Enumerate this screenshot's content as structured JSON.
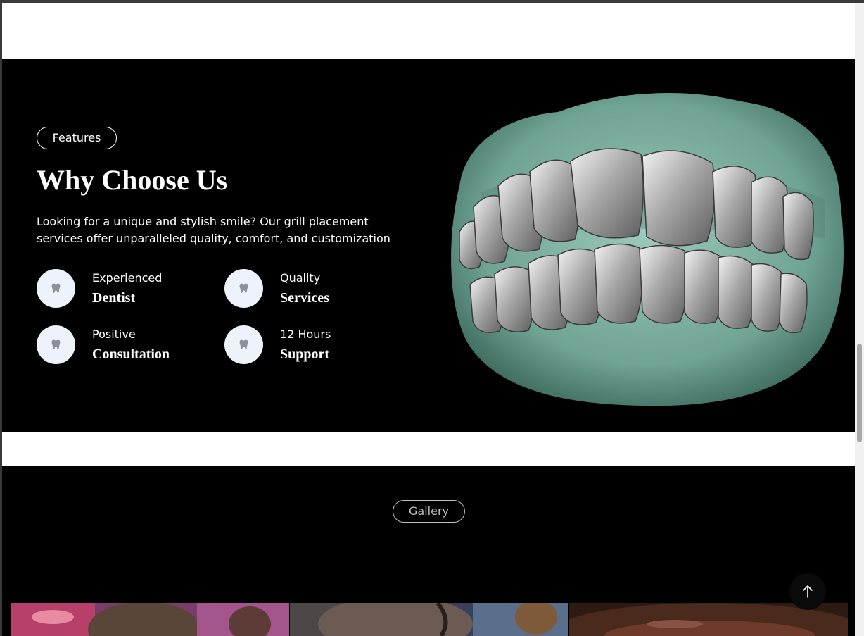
{
  "features_section": {
    "badge": "Features",
    "title": "Why Choose Us",
    "description": "Looking for a unique and stylish smile? Our grill placement services offer unparalleled quality, comfort, and customization",
    "items": [
      {
        "small": "Experienced",
        "big": "Dentist",
        "icon": "tooth-icon"
      },
      {
        "small": "Quality",
        "big": "Services",
        "icon": "tooth-icon"
      },
      {
        "small": "Positive",
        "big": "Consultation",
        "icon": "tooth-icon"
      },
      {
        "small": "12 Hours",
        "big": "Support",
        "icon": "tooth-icon"
      }
    ],
    "image": "silver-teeth-grill-image"
  },
  "gallery_section": {
    "badge": "Gallery",
    "images": [
      "gallery-photo-1",
      "gallery-photo-2",
      "gallery-photo-3"
    ]
  },
  "back_to_top": {
    "icon": "arrow-up-icon"
  },
  "colors": {
    "background": "#000000",
    "accent_circle": "#eef2fb",
    "text": "#ffffff"
  }
}
